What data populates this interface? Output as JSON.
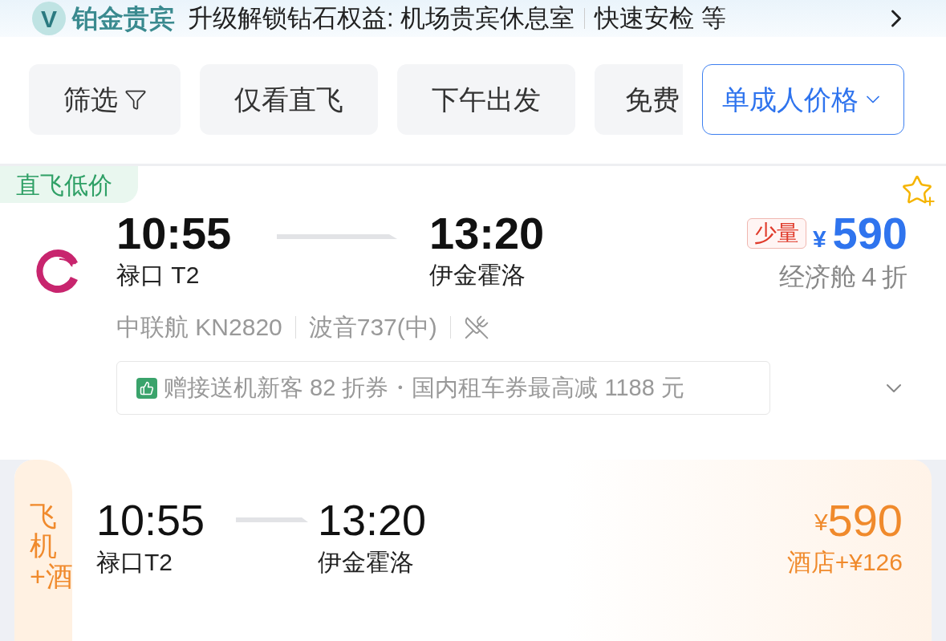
{
  "banner": {
    "badge": "V",
    "tier": "铂金贵宾",
    "benefits": "升级解锁钻石权益: 机场贵宾休息室",
    "more": "快速安检 等"
  },
  "filters": [
    {
      "kind": "filter",
      "label": "筛选",
      "selected": false
    },
    {
      "kind": "chip",
      "label": "仅看直飞",
      "selected": false
    },
    {
      "kind": "chip",
      "label": "下午出发",
      "selected": false
    },
    {
      "kind": "chip_cut",
      "label": "免费",
      "selected": false
    },
    {
      "kind": "dropdown",
      "label": "单成人价格",
      "selected": true
    }
  ],
  "flights": [
    {
      "kind": "flight",
      "tag": "直飞低价",
      "depart_time": "10:55",
      "depart_airport": "禄口 T2",
      "arrive_time": "13:20",
      "arrive_airport": "伊金霍洛",
      "stock": "少量",
      "currency": "¥",
      "price": "590",
      "cabin": "经济舱４折",
      "airline": "中联航 KN2820",
      "aircraft": "波音737(中)",
      "no_meal": true,
      "promo": "赠接送机新客 82 折券・国内租车券最高减 1188 元",
      "favorite": false
    },
    {
      "kind": "package",
      "tag": "飞机+酒",
      "depart_time": "10:55",
      "depart_airport": "禄口T2",
      "arrive_time": "13:20",
      "arrive_airport": "伊金霍洛",
      "currency": "¥",
      "price": "590",
      "extra": "酒店+¥126"
    }
  ]
}
